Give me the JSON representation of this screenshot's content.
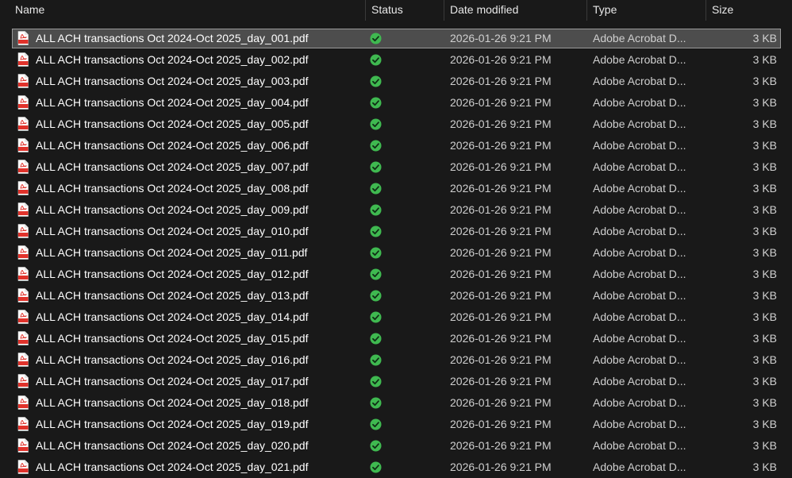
{
  "columns": {
    "name": "Name",
    "status": "Status",
    "date": "Date modified",
    "type": "Type",
    "size": "Size"
  },
  "colors": {
    "background": "#191919",
    "selected_background": "#4d4d4d",
    "status_green": "#3fb950",
    "pdf_red": "#e0322b"
  },
  "icons": {
    "file": "pdf-file-icon",
    "status": "available-checkmark-icon"
  },
  "selected_index": 0,
  "files": [
    {
      "name": "ALL ACH transactions Oct 2024-Oct 2025_day_001.pdf",
      "date": "2026-01-26 9:21 PM",
      "type": "Adobe Acrobat D...",
      "size": "3 KB"
    },
    {
      "name": "ALL ACH transactions Oct 2024-Oct 2025_day_002.pdf",
      "date": "2026-01-26 9:21 PM",
      "type": "Adobe Acrobat D...",
      "size": "3 KB"
    },
    {
      "name": "ALL ACH transactions Oct 2024-Oct 2025_day_003.pdf",
      "date": "2026-01-26 9:21 PM",
      "type": "Adobe Acrobat D...",
      "size": "3 KB"
    },
    {
      "name": "ALL ACH transactions Oct 2024-Oct 2025_day_004.pdf",
      "date": "2026-01-26 9:21 PM",
      "type": "Adobe Acrobat D...",
      "size": "3 KB"
    },
    {
      "name": "ALL ACH transactions Oct 2024-Oct 2025_day_005.pdf",
      "date": "2026-01-26 9:21 PM",
      "type": "Adobe Acrobat D...",
      "size": "3 KB"
    },
    {
      "name": "ALL ACH transactions Oct 2024-Oct 2025_day_006.pdf",
      "date": "2026-01-26 9:21 PM",
      "type": "Adobe Acrobat D...",
      "size": "3 KB"
    },
    {
      "name": "ALL ACH transactions Oct 2024-Oct 2025_day_007.pdf",
      "date": "2026-01-26 9:21 PM",
      "type": "Adobe Acrobat D...",
      "size": "3 KB"
    },
    {
      "name": "ALL ACH transactions Oct 2024-Oct 2025_day_008.pdf",
      "date": "2026-01-26 9:21 PM",
      "type": "Adobe Acrobat D...",
      "size": "3 KB"
    },
    {
      "name": "ALL ACH transactions Oct 2024-Oct 2025_day_009.pdf",
      "date": "2026-01-26 9:21 PM",
      "type": "Adobe Acrobat D...",
      "size": "3 KB"
    },
    {
      "name": "ALL ACH transactions Oct 2024-Oct 2025_day_010.pdf",
      "date": "2026-01-26 9:21 PM",
      "type": "Adobe Acrobat D...",
      "size": "3 KB"
    },
    {
      "name": "ALL ACH transactions Oct 2024-Oct 2025_day_011.pdf",
      "date": "2026-01-26 9:21 PM",
      "type": "Adobe Acrobat D...",
      "size": "3 KB"
    },
    {
      "name": "ALL ACH transactions Oct 2024-Oct 2025_day_012.pdf",
      "date": "2026-01-26 9:21 PM",
      "type": "Adobe Acrobat D...",
      "size": "3 KB"
    },
    {
      "name": "ALL ACH transactions Oct 2024-Oct 2025_day_013.pdf",
      "date": "2026-01-26 9:21 PM",
      "type": "Adobe Acrobat D...",
      "size": "3 KB"
    },
    {
      "name": "ALL ACH transactions Oct 2024-Oct 2025_day_014.pdf",
      "date": "2026-01-26 9:21 PM",
      "type": "Adobe Acrobat D...",
      "size": "3 KB"
    },
    {
      "name": "ALL ACH transactions Oct 2024-Oct 2025_day_015.pdf",
      "date": "2026-01-26 9:21 PM",
      "type": "Adobe Acrobat D...",
      "size": "3 KB"
    },
    {
      "name": "ALL ACH transactions Oct 2024-Oct 2025_day_016.pdf",
      "date": "2026-01-26 9:21 PM",
      "type": "Adobe Acrobat D...",
      "size": "3 KB"
    },
    {
      "name": "ALL ACH transactions Oct 2024-Oct 2025_day_017.pdf",
      "date": "2026-01-26 9:21 PM",
      "type": "Adobe Acrobat D...",
      "size": "3 KB"
    },
    {
      "name": "ALL ACH transactions Oct 2024-Oct 2025_day_018.pdf",
      "date": "2026-01-26 9:21 PM",
      "type": "Adobe Acrobat D...",
      "size": "3 KB"
    },
    {
      "name": "ALL ACH transactions Oct 2024-Oct 2025_day_019.pdf",
      "date": "2026-01-26 9:21 PM",
      "type": "Adobe Acrobat D...",
      "size": "3 KB"
    },
    {
      "name": "ALL ACH transactions Oct 2024-Oct 2025_day_020.pdf",
      "date": "2026-01-26 9:21 PM",
      "type": "Adobe Acrobat D...",
      "size": "3 KB"
    },
    {
      "name": "ALL ACH transactions Oct 2024-Oct 2025_day_021.pdf",
      "date": "2026-01-26 9:21 PM",
      "type": "Adobe Acrobat D...",
      "size": "3 KB"
    }
  ]
}
